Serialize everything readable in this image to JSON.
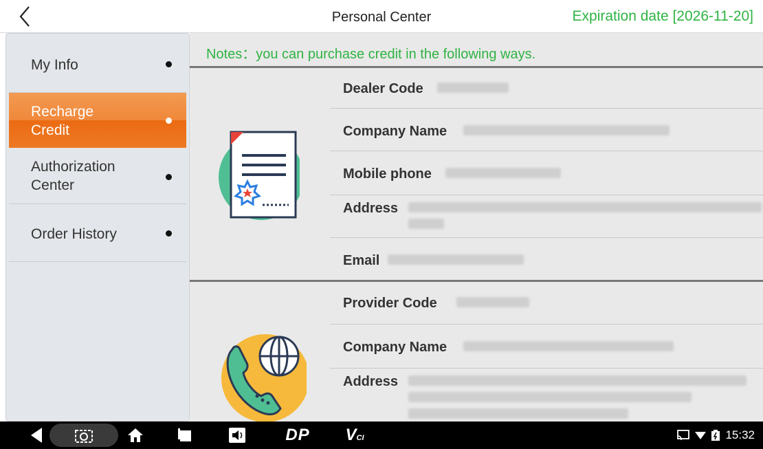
{
  "header": {
    "title": "Personal Center",
    "expiration": "Expiration date [2026-11-20]"
  },
  "sidebar": {
    "items": [
      {
        "label": "My Info",
        "active": false
      },
      {
        "label": "Recharge Credit",
        "active": true
      },
      {
        "label": "Authorization Center",
        "active": false
      },
      {
        "label": "Order History",
        "active": false
      }
    ]
  },
  "main": {
    "notes": "Notes：you can purchase credit in the following ways.",
    "dealer": {
      "fields": [
        "Dealer Code",
        "Company Name",
        "Mobile phone",
        "Address",
        "Email"
      ]
    },
    "provider": {
      "fields": [
        "Provider Code",
        "Company Name",
        "Address"
      ]
    }
  },
  "navbar": {
    "vci_label": "V",
    "vci_sub": "CI",
    "dp_label": "DP",
    "clock": "15:32"
  },
  "colors": {
    "accent_green": "#2fb343",
    "active_orange": "#ef7f2c"
  }
}
